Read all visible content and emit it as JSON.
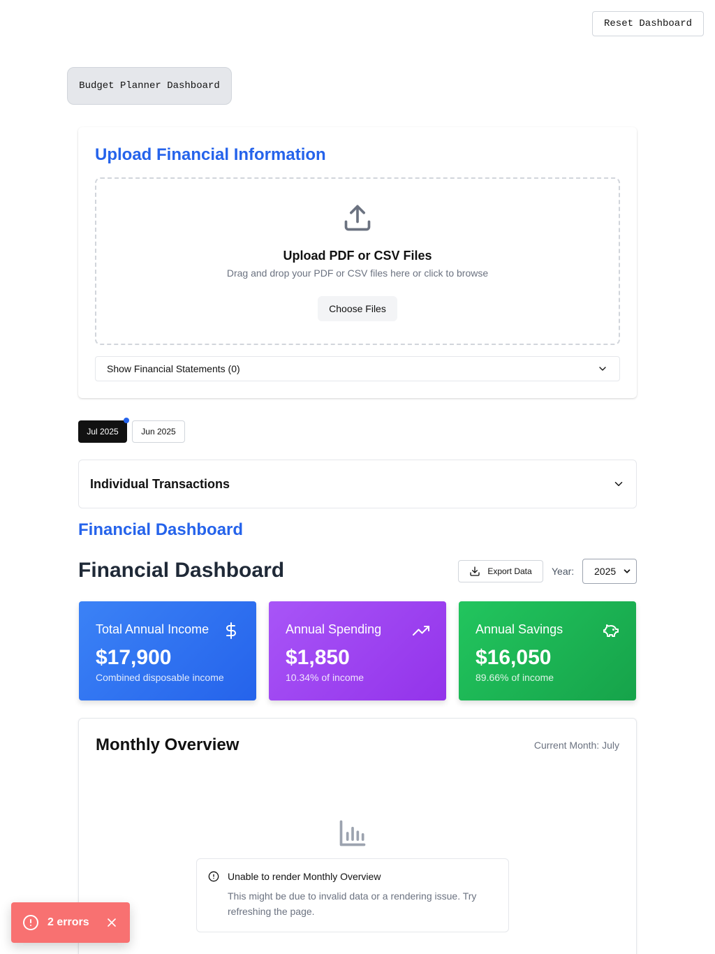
{
  "header": {
    "reset_label": "Reset Dashboard",
    "app_title": "Budget Planner Dashboard"
  },
  "upload": {
    "heading": "Upload Financial Information",
    "title": "Upload PDF or CSV Files",
    "subtitle": "Drag and drop your PDF or CSV files here or click to browse",
    "choose_label": "Choose Files",
    "statements_label": "Show Financial Statements (0)"
  },
  "months": {
    "tabs": [
      {
        "label": "Jul 2025",
        "active": true
      },
      {
        "label": "Jun 2025",
        "active": false
      }
    ]
  },
  "transactions": {
    "label": "Individual Transactions"
  },
  "dashboard": {
    "section_title": "Financial Dashboard",
    "title": "Financial Dashboard",
    "export_label": "Export Data",
    "year_label": "Year:",
    "year_value": "2025"
  },
  "cards": [
    {
      "label": "Total Annual Income",
      "value": "$17,900",
      "sub": "Combined disposable income",
      "icon": "dollar-icon"
    },
    {
      "label": "Annual Spending",
      "value": "$1,850",
      "sub": "10.34% of income",
      "icon": "trending-up-icon"
    },
    {
      "label": "Annual Savings",
      "value": "$16,050",
      "sub": "89.66% of income",
      "icon": "piggy-bank-icon"
    }
  ],
  "overview": {
    "title": "Monthly Overview",
    "current_month": "Current Month: July",
    "error_title": "Unable to render Monthly Overview",
    "error_message": "This might be due to invalid data or a rendering issue. Try refreshing the page."
  },
  "toast": {
    "text": "2 errors"
  },
  "colors": {
    "accent": "#2563eb",
    "income": "#2563eb",
    "spending": "#9333ea",
    "savings": "#16a34a",
    "error_toast": "#f87171"
  }
}
